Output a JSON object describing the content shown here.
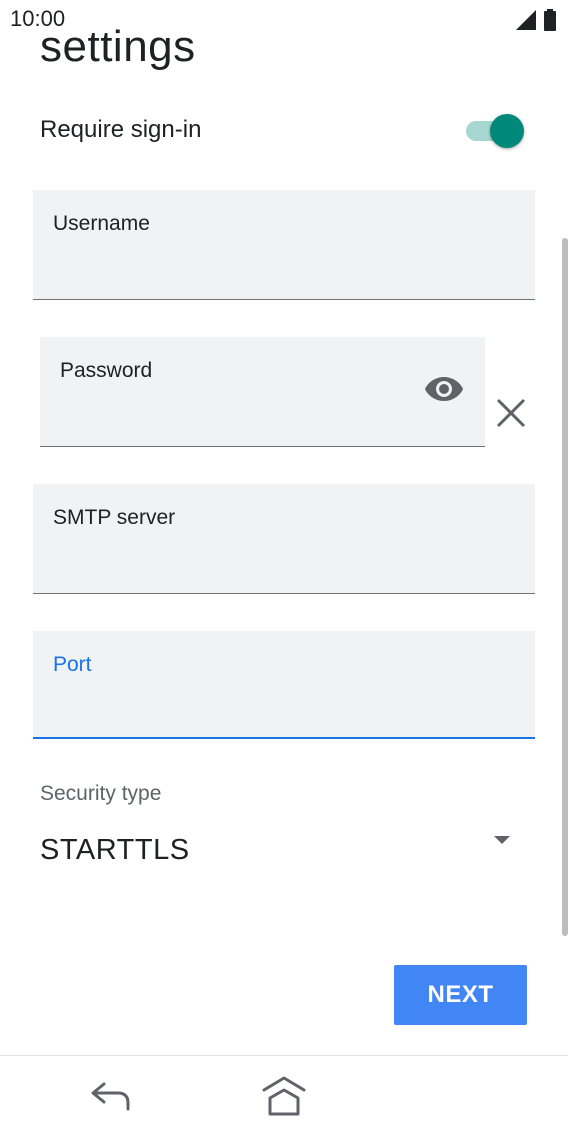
{
  "status_bar": {
    "time": "10:00",
    "signal_icon": "signal-icon",
    "battery_icon": "battery-icon"
  },
  "page": {
    "title": "settings"
  },
  "require_signin": {
    "label": "Require sign-in",
    "enabled": true
  },
  "fields": {
    "username": {
      "label": "Username",
      "value": ""
    },
    "password": {
      "label": "Password",
      "value": ""
    },
    "smtp_server": {
      "label": "SMTP server",
      "value": ""
    },
    "port": {
      "label": "Port",
      "value": ""
    }
  },
  "security": {
    "label": "Security type",
    "value": "STARTTLS"
  },
  "actions": {
    "next_label": "NEXT"
  },
  "colors": {
    "accent": "#00897b",
    "focus": "#1a73e8",
    "button": "#4285f4"
  }
}
